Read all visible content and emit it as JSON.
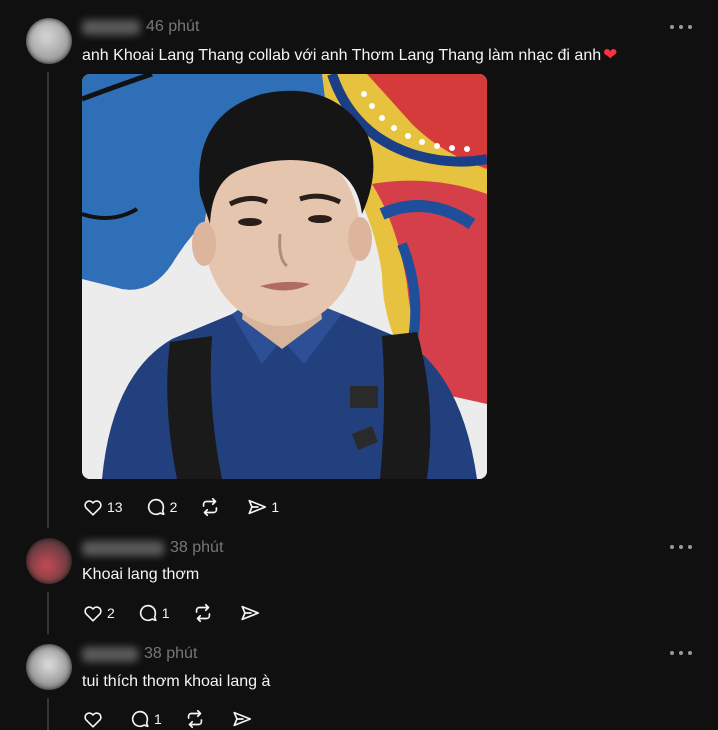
{
  "comments": [
    {
      "time": "46 phút",
      "text": "anh Khoai Lang Thang collab với anh Thơm Lang Thang làm nhạc đi anh",
      "emoji": "❤",
      "has_image": true,
      "likes": "13",
      "replies": "2",
      "reposts": "",
      "shares": "1"
    },
    {
      "time": "38 phút",
      "text": "Khoai lang thơm",
      "likes": "2",
      "replies": "1",
      "reposts": "",
      "shares": ""
    },
    {
      "time": "38 phút",
      "text": "tui thích thơm khoai lang à",
      "likes": "",
      "replies": "1",
      "reposts": "",
      "shares": ""
    }
  ],
  "icons": {
    "like": "heart-icon",
    "reply": "comment-icon",
    "repost": "repost-icon",
    "share": "send-icon",
    "more": "more-icon"
  },
  "colors": {
    "background": "#101010",
    "text": "#f3f5f7",
    "muted": "#777777",
    "heart": "#ff3040"
  }
}
